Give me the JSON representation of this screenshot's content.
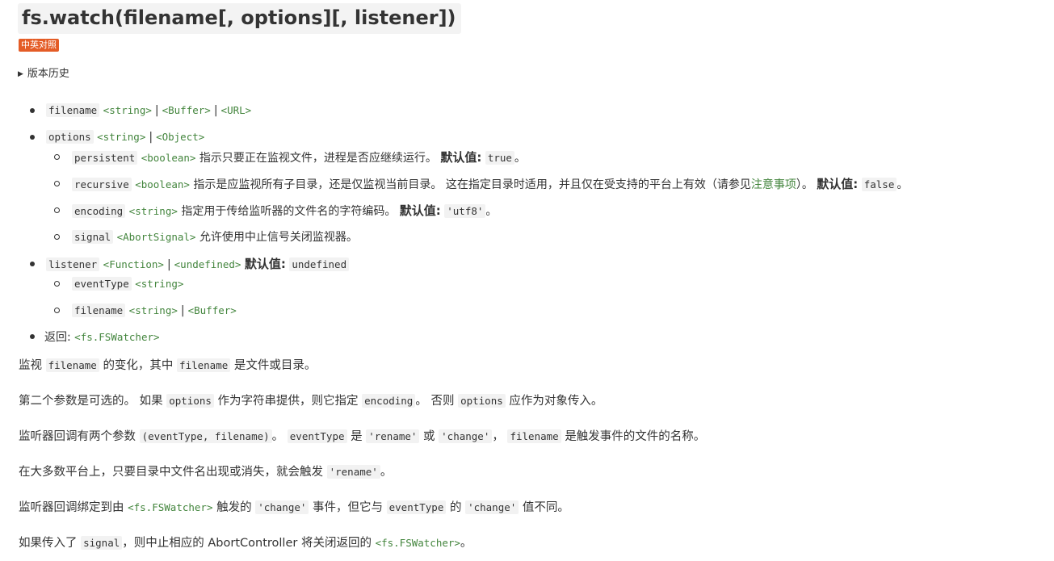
{
  "title": "fs.watch(filename[, options][, listener])",
  "badge": "中英对照",
  "history": "版本历史",
  "params": {
    "filename": {
      "name": "filename",
      "types": [
        "<string>",
        "<Buffer>",
        "<URL>"
      ]
    },
    "options": {
      "name": "options",
      "types": [
        "<string>",
        "<Object>"
      ],
      "persistent": {
        "name": "persistent",
        "type": "<boolean>",
        "desc": "指示只要正在监视文件，进程是否应继续运行。",
        "default_label": "默认值:",
        "default_value": "true",
        "end": "。"
      },
      "recursive": {
        "name": "recursive",
        "type": "<boolean>",
        "desc": "指示是应监视所有子目录，还是仅监视当前目录。 这在指定目录时适用，并且仅在受支持的平台上有效（请参见",
        "link": "注意事项",
        "desc_end": "）。",
        "default_label": "默认值:",
        "default_value": "false",
        "end": "。"
      },
      "encoding": {
        "name": "encoding",
        "type": "<string>",
        "desc": "指定用于传给监听器的文件名的字符编码。",
        "default_label": "默认值:",
        "default_value": "'utf8'",
        "end": "。"
      },
      "signal": {
        "name": "signal",
        "type": "<AbortSignal>",
        "desc": "允许使用中止信号关闭监视器。"
      }
    },
    "listener": {
      "name": "listener",
      "types": [
        "<Function>",
        "<undefined>"
      ],
      "default_label": "默认值:",
      "default_value": "undefined",
      "eventType": {
        "name": "eventType",
        "type": "<string>"
      },
      "filename": {
        "name": "filename",
        "types": [
          "<string>",
          "<Buffer>"
        ]
      }
    },
    "returns": {
      "label": "返回:",
      "type": "<fs.FSWatcher>"
    }
  },
  "paragraphs": {
    "p1": {
      "a": "监视",
      "c1": "filename",
      "b": "的变化，其中",
      "c2": "filename",
      "d": "是文件或目录。"
    },
    "p2": {
      "a": "第二个参数是可选的。 如果",
      "c1": "options",
      "b": "作为字符串提供，则它指定",
      "c2": "encoding",
      "d": "。 否则",
      "c3": "options",
      "e": "应作为对象传入。"
    },
    "p3": {
      "a": "监听器回调有两个参数",
      "c1": "(eventType, filename)",
      "b": "。",
      "c2": "eventType",
      "d": "是",
      "c3": "'rename'",
      "e": "或",
      "c4": "'change'",
      "f": "，",
      "c5": "filename",
      "g": "是触发事件的文件的名称。"
    },
    "p4": {
      "a": "在大多数平台上，只要目录中文件名出现或消失，就会触发",
      "c1": "'rename'",
      "b": "。"
    },
    "p5": {
      "a": "监听器回调绑定到由",
      "t1": "<fs.FSWatcher>",
      "b": "触发的",
      "c1": "'change'",
      "d": "事件，但它与",
      "c2": "eventType",
      "e": "的",
      "c3": "'change'",
      "f": "值不同。"
    },
    "p6": {
      "a": "如果传入了",
      "c1": "signal",
      "b": "，则中止相应的 AbortController 将关闭返回的",
      "t1": "<fs.FSWatcher>",
      "c": "。"
    }
  },
  "colors": {
    "accent_green": "#43853d",
    "badge_bg": "#e45c26",
    "code_bg": "#f2f2f2",
    "text": "#333333"
  }
}
